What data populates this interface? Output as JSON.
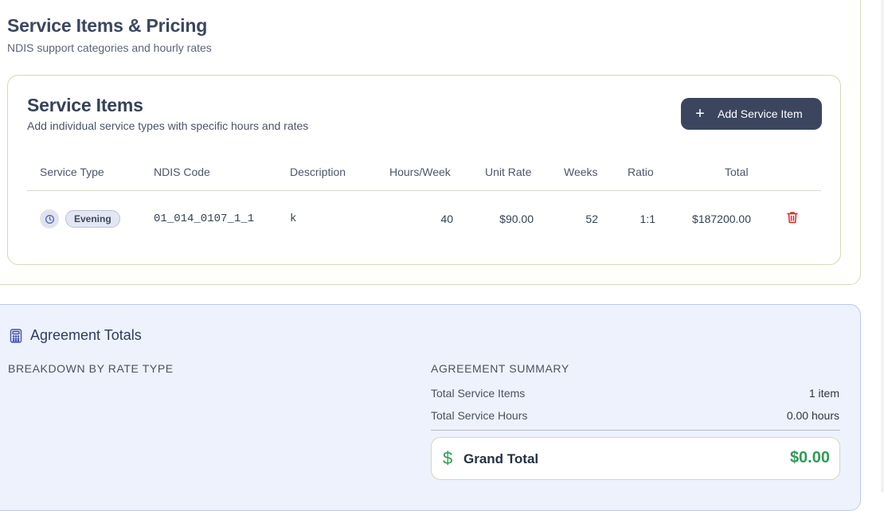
{
  "section": {
    "title": "Service Items & Pricing",
    "subtitle": "NDIS support categories and hourly rates"
  },
  "service_items": {
    "title": "Service Items",
    "subtitle": "Add individual service types with specific hours and rates",
    "add_button_label": "Add Service Item",
    "columns": [
      "Service Type",
      "NDIS Code",
      "Description",
      "Hours/Week",
      "Unit Rate",
      "Weeks",
      "Ratio",
      "Total"
    ],
    "rows": [
      {
        "service_type": "Evening",
        "ndis_code": "01_014_0107_1_1",
        "description": "k",
        "hours_week": "40",
        "unit_rate": "$90.00",
        "weeks": "52",
        "ratio": "1:1",
        "total": "$187200.00"
      }
    ]
  },
  "totals": {
    "title": "Agreement Totals",
    "breakdown_heading": "BREAKDOWN BY RATE TYPE",
    "summary_heading": "AGREEMENT SUMMARY",
    "total_items_label": "Total Service Items",
    "total_items_value": "1 item",
    "total_hours_label": "Total Service Hours",
    "total_hours_value": "0.00 hours",
    "grand_total_label": "Grand Total",
    "grand_total_value": "$0.00"
  },
  "colors": {
    "primary_button": "#3b465e",
    "grand_total_green": "#2f9b55",
    "delete_red": "#dc2626",
    "totals_bg": "#eef2fd"
  },
  "icons": {
    "add": "plus-icon",
    "service_type": "clock-icon",
    "delete": "trash-icon",
    "totals": "calculator-icon",
    "grand_total": "dollar-icon"
  }
}
